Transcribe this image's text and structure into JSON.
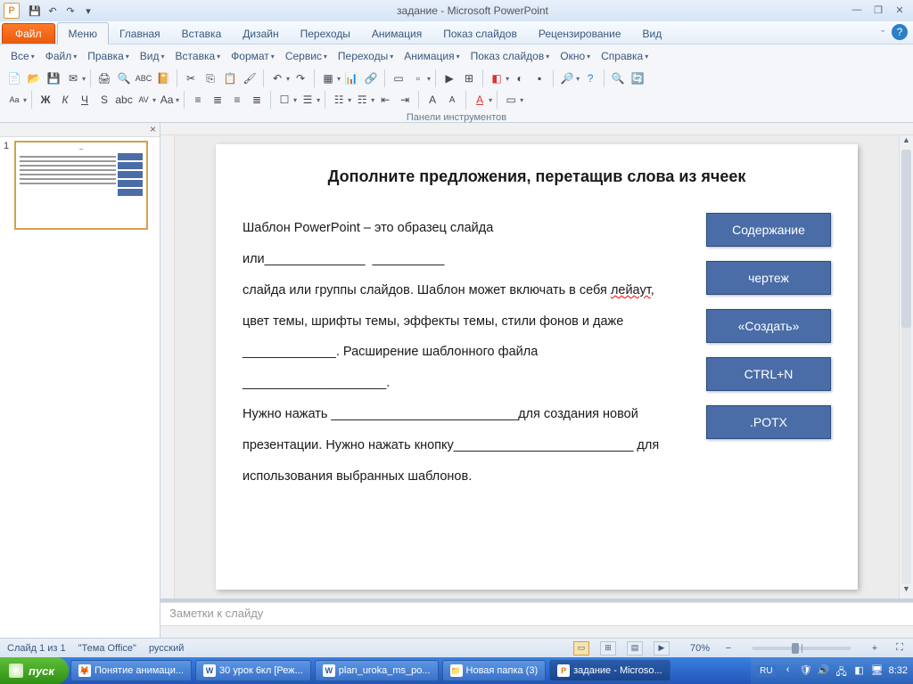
{
  "title": "задание  -  Microsoft PowerPoint",
  "qat": {
    "save": "💾",
    "undo": "↶",
    "redo": "↷",
    "more": "▾"
  },
  "win": {
    "min": "―",
    "max": "❐",
    "close": "✕"
  },
  "tabs": {
    "file": "Файл",
    "items": [
      "Меню",
      "Главная",
      "Вставка",
      "Дизайн",
      "Переходы",
      "Анимация",
      "Показ слайдов",
      "Рецензирование",
      "Вид"
    ],
    "active": 0
  },
  "menuRow": [
    "Все",
    "Файл",
    "Правка",
    "Вид",
    "Вставка",
    "Формат",
    "Сервис",
    "Переходы",
    "Анимация",
    "Показ слайдов",
    "Окно",
    "Справка"
  ],
  "ribbonLabel": "Панели инструментов",
  "thumbs": {
    "num": "1"
  },
  "slide": {
    "title": "Дополните предложения, перетащив слова из ячеек",
    "para": "Шаблон PowerPoint – это образец слайда или______________  __________   слайда или группы слайдов. Шаблон может включать в себя лейаут, цвет темы, шрифты темы, эффекты темы, стили фонов и даже _____________. Расширение шаблонного файла ____________________.  Нужно нажать __________________________для создания новой презентации. Нужно нажать кнопку_________________________ для использования выбранных шаблонов.",
    "boxes": [
      "Содержание",
      "чертеж",
      "«Создать»",
      "CTRL+N",
      ".POTX"
    ]
  },
  "notesPlaceholder": "Заметки к слайду",
  "status": {
    "slide": "Слайд 1 из 1",
    "theme": "\"Тема Office\"",
    "lang": "русский",
    "zoom": "70%"
  },
  "taskbar": {
    "start": "пуск",
    "items": [
      {
        "ico": "🦊",
        "label": "Понятие анимаци..."
      },
      {
        "ico": "W",
        "label": "30 урок 6кл [Реж..."
      },
      {
        "ico": "W",
        "label": "plan_uroka_ms_po..."
      },
      {
        "ico": "📁",
        "label": "Новая папка (3)"
      },
      {
        "ico": "P",
        "label": "задание - Microso...",
        "active": true
      }
    ],
    "lang": "RU",
    "clock": "8:32"
  }
}
